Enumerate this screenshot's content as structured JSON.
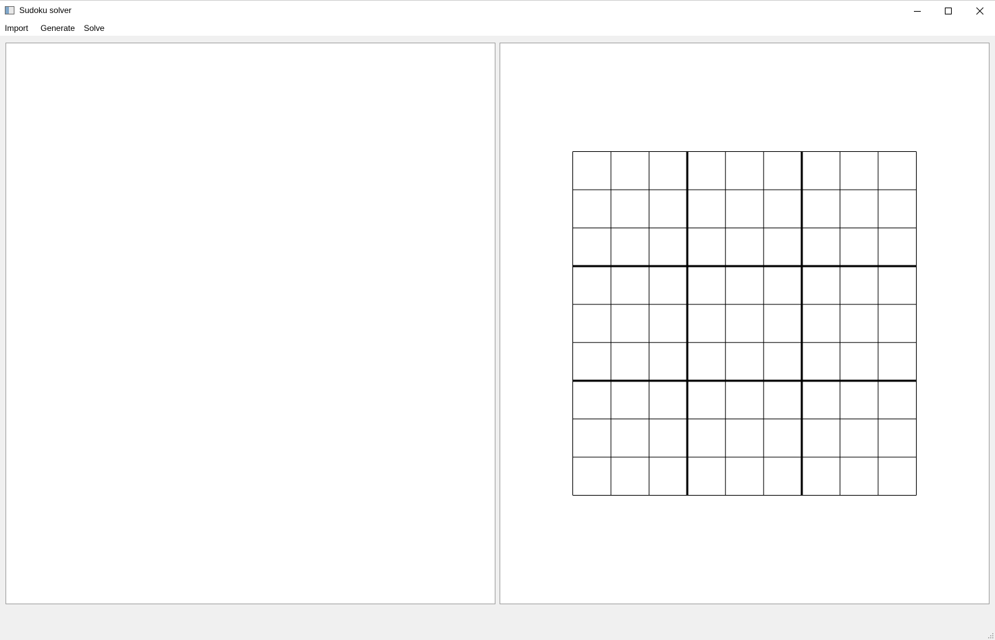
{
  "window": {
    "title": "Sudoku solver",
    "icon": "app-window-icon"
  },
  "controls": {
    "minimize": "minimize-icon",
    "maximize": "maximize-icon",
    "close": "close-icon"
  },
  "menu": {
    "items": [
      {
        "label": "Import"
      },
      {
        "label": "Generate"
      },
      {
        "label": "Solve"
      }
    ]
  },
  "board": {
    "rows": 9,
    "cols": 9,
    "box_size": 3,
    "cells": [
      [
        "",
        "",
        "",
        "",
        "",
        "",
        "",
        "",
        ""
      ],
      [
        "",
        "",
        "",
        "",
        "",
        "",
        "",
        "",
        ""
      ],
      [
        "",
        "",
        "",
        "",
        "",
        "",
        "",
        "",
        ""
      ],
      [
        "",
        "",
        "",
        "",
        "",
        "",
        "",
        "",
        ""
      ],
      [
        "",
        "",
        "",
        "",
        "",
        "",
        "",
        "",
        ""
      ],
      [
        "",
        "",
        "",
        "",
        "",
        "",
        "",
        "",
        ""
      ],
      [
        "",
        "",
        "",
        "",
        "",
        "",
        "",
        "",
        ""
      ],
      [
        "",
        "",
        "",
        "",
        "",
        "",
        "",
        "",
        ""
      ],
      [
        "",
        "",
        "",
        "",
        "",
        "",
        "",
        "",
        ""
      ]
    ]
  },
  "colors": {
    "grid_line": "#000000",
    "panel_background": "#ffffff",
    "window_background": "#f0f0f0"
  }
}
